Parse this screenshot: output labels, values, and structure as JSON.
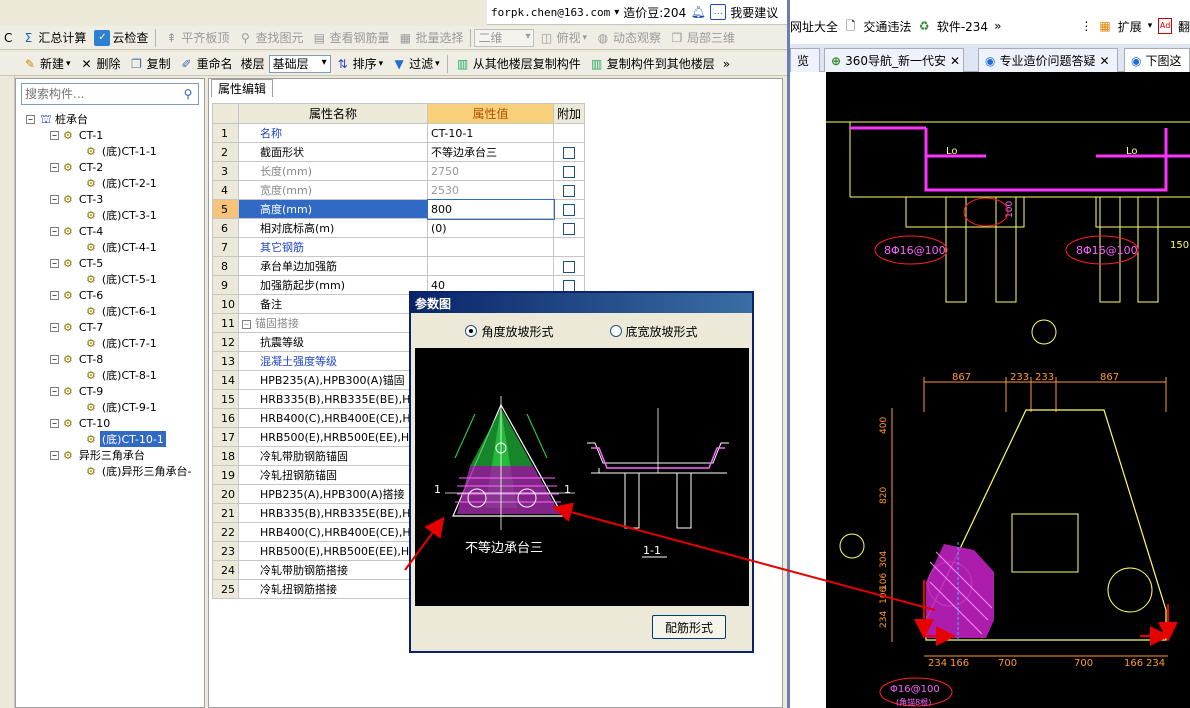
{
  "top_toolbar": {
    "items": [
      {
        "label": "C",
        "icon": "letter-c"
      },
      {
        "label": "汇总计算",
        "icon": "sum-icon"
      },
      {
        "label": "云检查",
        "icon": "cloud-check-icon"
      },
      {
        "label": "平齐板顶",
        "icon": "align-top-icon"
      },
      {
        "label": "查找图元",
        "icon": "binoculars-icon"
      },
      {
        "label": "查看钢筋量",
        "icon": "rebar-view-icon"
      },
      {
        "label": "批量选择",
        "icon": "batch-select-icon"
      },
      {
        "label": "二维",
        "icon": "combo"
      },
      {
        "label": "俯视",
        "icon": "top-view-icon"
      },
      {
        "label": "动态观察",
        "icon": "orbit-icon"
      },
      {
        "label": "局部三维",
        "icon": "local-3d-icon"
      }
    ]
  },
  "user_bar": {
    "email": "forpk.chen@163.com",
    "dropdown": "▾",
    "points_label": "造价豆:204",
    "suggest_label": "我要建议"
  },
  "second_toolbar": {
    "new": "新建",
    "delete": "删除",
    "copy": "复制",
    "rename": "重命名",
    "floor_label": "楼层",
    "floor_value": "基础层",
    "sort": "排序",
    "filter": "过滤",
    "copy_from": "从其他楼层复制构件",
    "copy_to": "复制构件到其他楼层",
    "more": "»"
  },
  "tree": {
    "search_placeholder": "搜索构件...",
    "root": "桩承台",
    "nodes": [
      {
        "label": "CT-1",
        "child": "(底)CT-1-1"
      },
      {
        "label": "CT-2",
        "child": "(底)CT-2-1"
      },
      {
        "label": "CT-3",
        "child": "(底)CT-3-1"
      },
      {
        "label": "CT-4",
        "child": "(底)CT-4-1"
      },
      {
        "label": "CT-5",
        "child": "(底)CT-5-1"
      },
      {
        "label": "CT-6",
        "child": "(底)CT-6-1"
      },
      {
        "label": "CT-7",
        "child": "(底)CT-7-1"
      },
      {
        "label": "CT-8",
        "child": "(底)CT-8-1"
      },
      {
        "label": "CT-9",
        "child": "(底)CT-9-1"
      },
      {
        "label": "CT-10",
        "child": "(底)CT-10-1"
      },
      {
        "label": "异形三角承台",
        "child": "(底)异形三角承台-"
      }
    ]
  },
  "props": {
    "tab": "属性编辑",
    "headers": {
      "name": "属性名称",
      "value": "属性值",
      "extra": "附加"
    },
    "rows": [
      {
        "n": "1",
        "name": "名称",
        "value": "CT-10-1",
        "style": "blue",
        "cb": false
      },
      {
        "n": "2",
        "name": "截面形状",
        "value": "不等边承台三",
        "style": "",
        "cb": true
      },
      {
        "n": "3",
        "name": "长度(mm)",
        "value": "2750",
        "style": "gray",
        "cb": true
      },
      {
        "n": "4",
        "name": "宽度(mm)",
        "value": "2530",
        "style": "gray",
        "cb": true
      },
      {
        "n": "5",
        "name": "高度(mm)",
        "value": "800",
        "style": "sel",
        "cb": true
      },
      {
        "n": "6",
        "name": "相对底标高(m)",
        "value": "(0)",
        "style": "",
        "cb": true
      },
      {
        "n": "7",
        "name": "其它钢筋",
        "value": "",
        "style": "blue",
        "cb": false
      },
      {
        "n": "8",
        "name": "承台单边加强筋",
        "value": "",
        "style": "",
        "cb": true
      },
      {
        "n": "9",
        "name": "加强筋起步(mm)",
        "value": "40",
        "style": "",
        "cb": true
      },
      {
        "n": "10",
        "name": "备注",
        "value": "",
        "style": "",
        "cb": false
      },
      {
        "n": "11",
        "name": "锚固搭接",
        "value": "",
        "style": "gray",
        "cb": false,
        "toggle": "−"
      },
      {
        "n": "12",
        "name": "抗震等级",
        "value": "",
        "style": "",
        "cb": false,
        "indent": true
      },
      {
        "n": "13",
        "name": "混凝土强度等级",
        "value": "",
        "style": "blue",
        "cb": false,
        "indent": true
      },
      {
        "n": "14",
        "name": "HPB235(A),HPB300(A)锚固",
        "value": "",
        "style": "",
        "cb": false,
        "indent": true
      },
      {
        "n": "15",
        "name": "HRB335(B),HRB335E(BE),HR",
        "value": "",
        "style": "",
        "cb": false,
        "indent": true
      },
      {
        "n": "16",
        "name": "HRB400(C),HRB400E(CE),HR",
        "value": "",
        "style": "",
        "cb": false,
        "indent": true
      },
      {
        "n": "17",
        "name": "HRB500(E),HRB500E(EE),HR",
        "value": "",
        "style": "",
        "cb": false,
        "indent": true
      },
      {
        "n": "18",
        "name": "冷轧带肋钢筋锚固",
        "value": "",
        "style": "",
        "cb": false,
        "indent": true
      },
      {
        "n": "19",
        "name": "冷轧扭钢筋锚固",
        "value": "",
        "style": "",
        "cb": false,
        "indent": true
      },
      {
        "n": "20",
        "name": "HPB235(A),HPB300(A)搭接",
        "value": "",
        "style": "",
        "cb": false,
        "indent": true
      },
      {
        "n": "21",
        "name": "HRB335(B),HRB335E(BE),HR",
        "value": "",
        "style": "",
        "cb": false,
        "indent": true
      },
      {
        "n": "22",
        "name": "HRB400(C),HRB400E(CE),HR",
        "value": "",
        "style": "",
        "cb": false,
        "indent": true
      },
      {
        "n": "23",
        "name": "HRB500(E),HRB500E(EE),HR",
        "value": "",
        "style": "",
        "cb": false,
        "indent": true
      },
      {
        "n": "24",
        "name": "冷轧带肋钢筋搭接",
        "value": "",
        "style": "",
        "cb": false,
        "indent": true
      },
      {
        "n": "25",
        "name": "冷轧扭钢筋搭接",
        "value": "",
        "style": "",
        "cb": false,
        "indent": true
      }
    ]
  },
  "dialog": {
    "title": "参数图",
    "option1": "角度放坡形式",
    "option2": "底宽放坡形式",
    "caption": "不等边承台三",
    "section": "1-1",
    "sec_mark": "1",
    "button": "配筋形式"
  },
  "browser": {
    "bookmarks": [
      "网址大全",
      "交通违法",
      "软件-234",
      "»",
      "扩展",
      "翻"
    ],
    "tabs": [
      {
        "label": "览"
      },
      {
        "label": "360导航_新一代安"
      },
      {
        "label": "专业造价问题答疑"
      },
      {
        "label": "下图这"
      }
    ]
  },
  "cad": {
    "lo_left": "Lo",
    "lo_right": "Lo",
    "dim100": "100",
    "rebar1": "8Φ16@100",
    "rebar2": "8Φ16@100",
    "dim150": "150",
    "top_dims": [
      "867",
      "233",
      "233",
      "867"
    ],
    "side_dims": [
      "400",
      "820",
      "304",
      "106",
      "106",
      "234"
    ],
    "bottom_dims": [
      "234",
      "166",
      "700",
      "700",
      "166",
      "234"
    ],
    "rebar3": "Φ16@100",
    "rebar3_note": "(角锚8根)"
  },
  "colors": {
    "accent": "#316ac5",
    "annotation_arrow": "#e60000",
    "cad_bg": "#000000",
    "magenta": "#ff00ff",
    "cad_yellow": "#ffff66"
  }
}
